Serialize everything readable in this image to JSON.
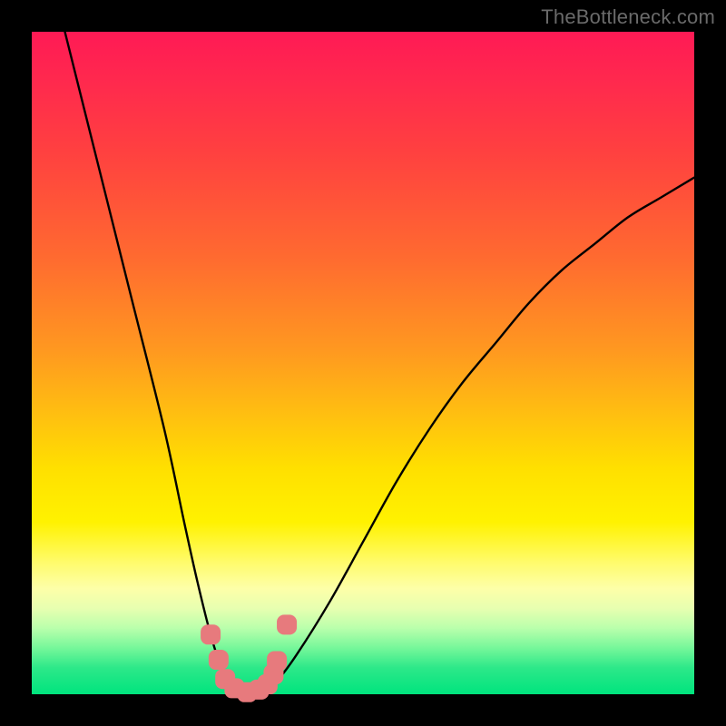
{
  "watermark": "TheBottleneck.com",
  "chart_data": {
    "type": "line",
    "title": "",
    "xlabel": "",
    "ylabel": "",
    "xlim": [
      0,
      100
    ],
    "ylim": [
      0,
      100
    ],
    "series": [
      {
        "name": "bottleneck-curve",
        "x": [
          5,
          10,
          15,
          20,
          23,
          25,
          27,
          29,
          31,
          33,
          35,
          37,
          40,
          45,
          50,
          55,
          60,
          65,
          70,
          75,
          80,
          85,
          90,
          95,
          100
        ],
        "values": [
          100,
          80,
          60,
          40,
          26,
          17,
          9,
          3,
          0.5,
          0,
          0.5,
          2,
          6,
          14,
          23,
          32,
          40,
          47,
          53,
          59,
          64,
          68,
          72,
          75,
          78
        ]
      }
    ],
    "markers": {
      "name": "highlight-dots",
      "x": [
        27.0,
        28.2,
        29.2,
        30.6,
        32.5,
        34.3,
        35.6,
        36.5,
        37.0,
        38.5
      ],
      "values": [
        9.0,
        5.2,
        2.3,
        0.9,
        0.3,
        0.7,
        1.5,
        3.0,
        5.0,
        10.5
      ]
    },
    "gradient_bands": [
      {
        "color": "#ff1a55",
        "from": 100,
        "to": 80
      },
      {
        "color": "#ff6a30",
        "from": 80,
        "to": 55
      },
      {
        "color": "#ffe000",
        "from": 55,
        "to": 25
      },
      {
        "color": "#fdffa8",
        "from": 25,
        "to": 12
      },
      {
        "color": "#00e47e",
        "from": 12,
        "to": 0
      }
    ]
  }
}
